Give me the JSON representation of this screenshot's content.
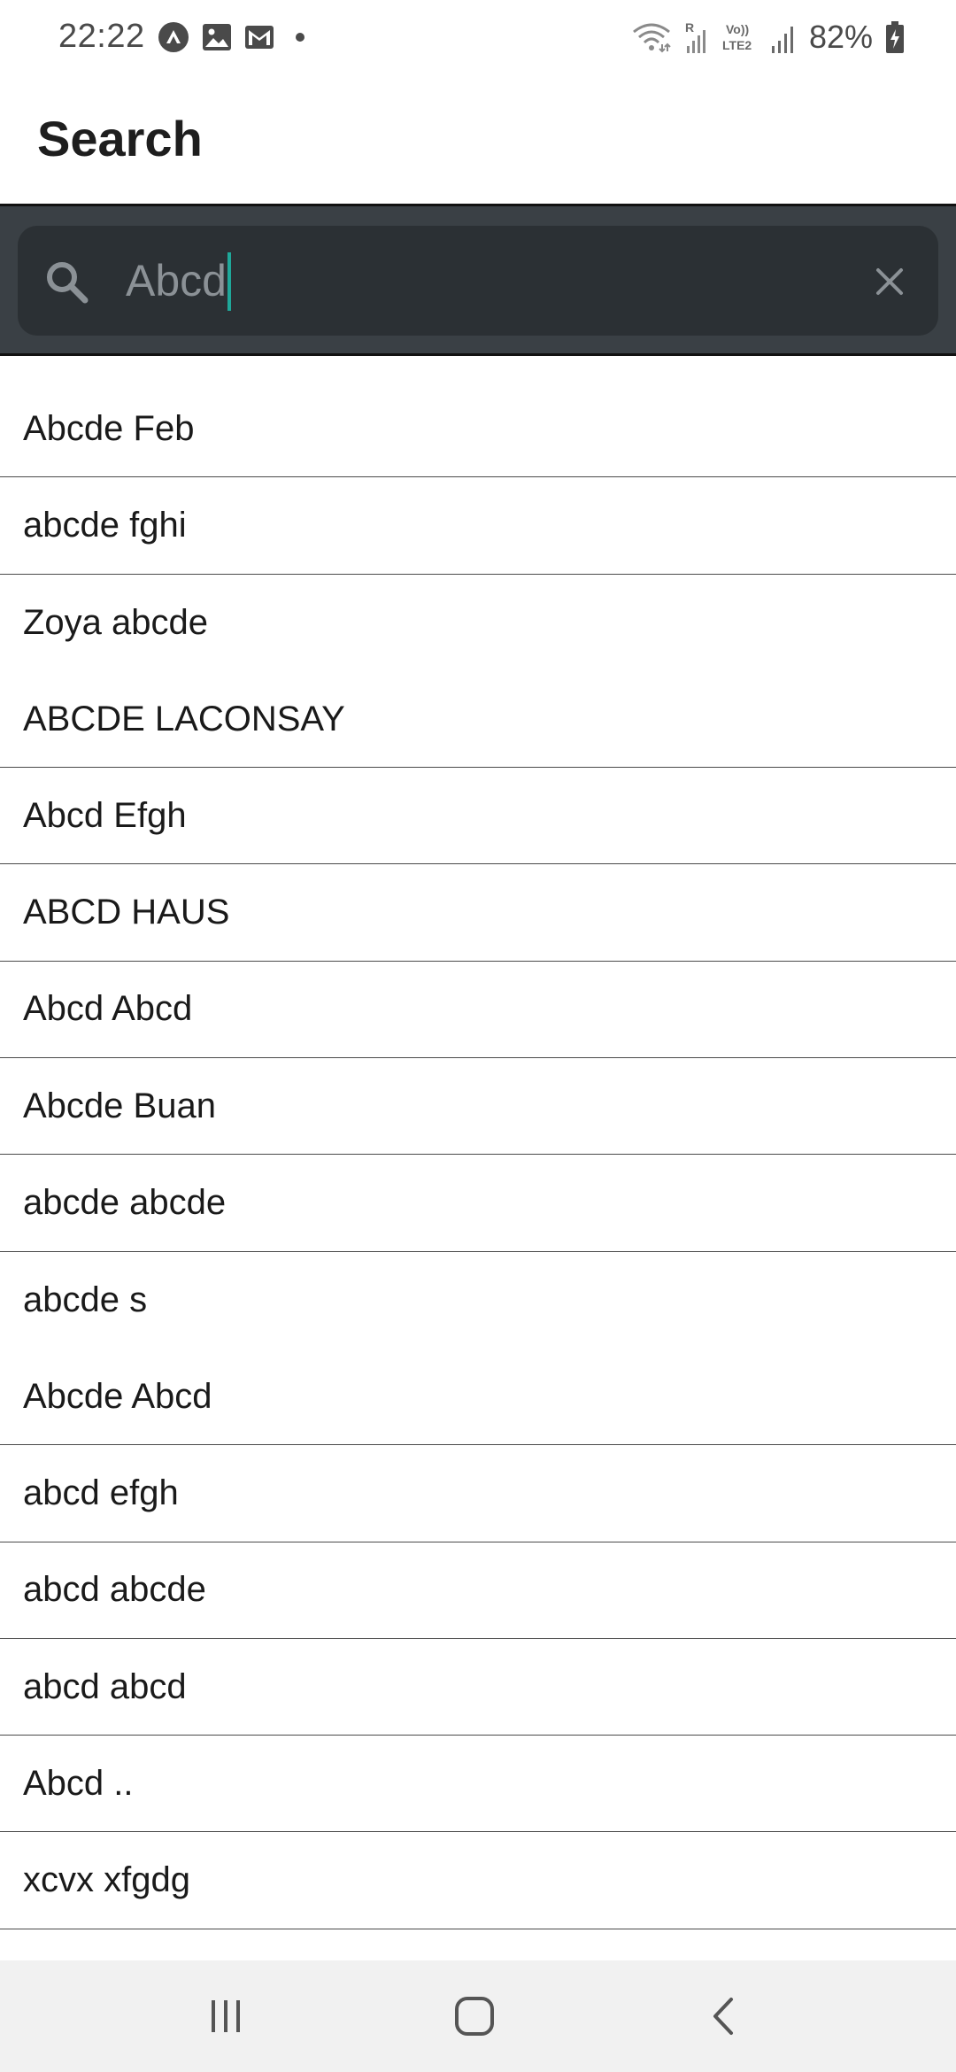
{
  "status_bar": {
    "time": "22:22",
    "battery_percent": "82%",
    "left_icons": [
      "arc-app-icon",
      "gallery-icon",
      "gmail-icon",
      "dot-icon"
    ],
    "right_icons": [
      "wifi-icon",
      "roaming-signal-icon",
      "volte-icon",
      "signal-icon",
      "battery-charging-icon"
    ],
    "volte_label_top": "Vo))",
    "volte_label_bottom": "LTE2",
    "roaming_label": "R"
  },
  "app_bar": {
    "title": "Search"
  },
  "search": {
    "value": "Abcd",
    "accent_color": "#1fa89a"
  },
  "results": [
    {
      "label": "Abcde Feb",
      "divider": true
    },
    {
      "label": "abcde fghi",
      "divider": true
    },
    {
      "label": "Zoya abcde",
      "divider": false
    },
    {
      "label": "ABCDE LACONSAY",
      "divider": true
    },
    {
      "label": "Abcd Efgh",
      "divider": true
    },
    {
      "label": "ABCD HAUS",
      "divider": true
    },
    {
      "label": "Abcd Abcd",
      "divider": true
    },
    {
      "label": "Abcde Buan",
      "divider": true
    },
    {
      "label": "abcde abcde",
      "divider": true
    },
    {
      "label": "abcde s",
      "divider": false
    },
    {
      "label": "Abcde Abcd",
      "divider": true
    },
    {
      "label": "abcd efgh",
      "divider": true
    },
    {
      "label": "abcd abcde",
      "divider": true
    },
    {
      "label": "abcd abcd",
      "divider": true
    },
    {
      "label": "Abcd ..",
      "divider": true
    },
    {
      "label": "xcvx xfgdg",
      "divider": true
    }
  ],
  "nav_bar": {
    "buttons": [
      "recents-icon",
      "home-icon",
      "back-icon"
    ]
  }
}
